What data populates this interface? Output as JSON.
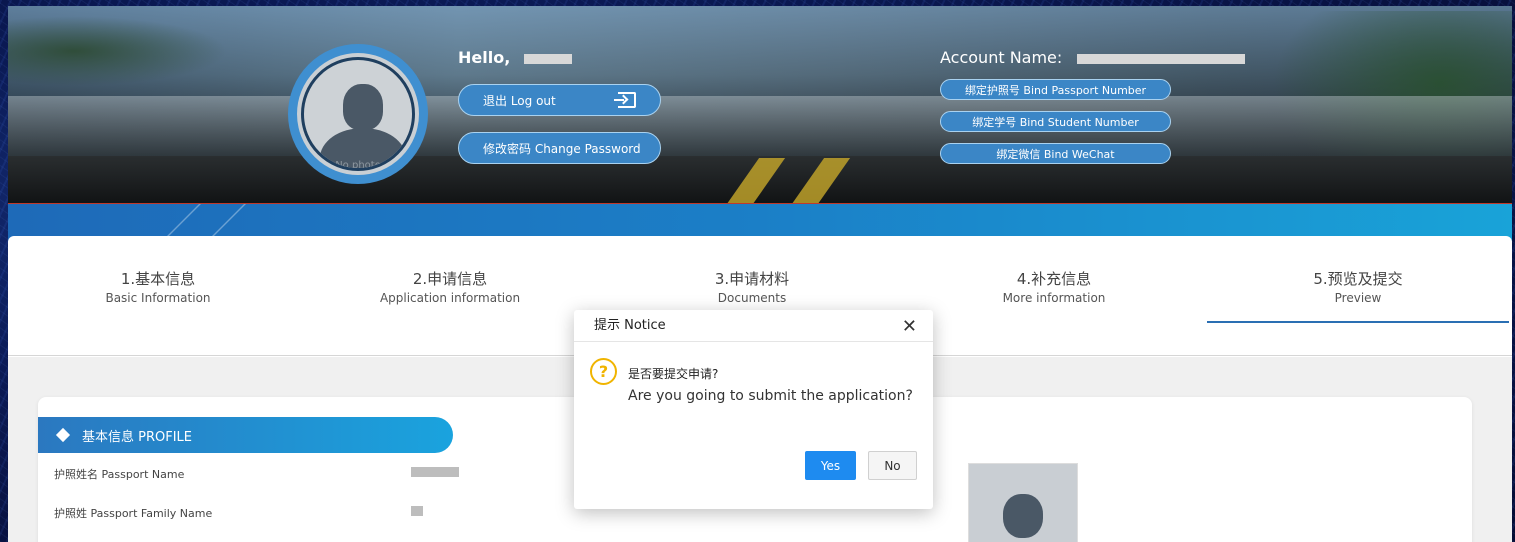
{
  "header": {
    "hello_label": "Hello,",
    "no_photo": "No photo",
    "logout_label": "退出 Log out",
    "change_password_label": "修改密码 Change Password",
    "account_name_label": "Account Name:",
    "bind_passport_label": "绑定护照号 Bind Passport Number",
    "bind_student_label": "绑定学号 Bind Student Number",
    "bind_wechat_label": "绑定微信 Bind WeChat"
  },
  "steps": [
    {
      "cn": "1.基本信息",
      "en": "Basic Information"
    },
    {
      "cn": "2.申请信息",
      "en": "Application information"
    },
    {
      "cn": "3.申请材料",
      "en": "Documents"
    },
    {
      "cn": "4.补充信息",
      "en": "More information"
    },
    {
      "cn": "5.预览及提交",
      "en": "Preview"
    }
  ],
  "active_step": 5,
  "profile": {
    "section_title": "基本信息 PROFILE",
    "fields": [
      {
        "label": "护照姓名 Passport Name"
      },
      {
        "label": "护照姓 Passport Family Name"
      }
    ]
  },
  "dialog": {
    "title": "提示 Notice",
    "close_symbol": "✕",
    "icon_symbol": "?",
    "message_cn": "是否要提交申请?",
    "message_en": "Are you going to submit the application?",
    "yes_label": "Yes",
    "no_label": "No"
  },
  "colors": {
    "accent": "#3b86c6",
    "primary_button": "#1e8bf0",
    "warning_icon": "#f0b400",
    "active_step_underline": "#2a6fb3"
  }
}
